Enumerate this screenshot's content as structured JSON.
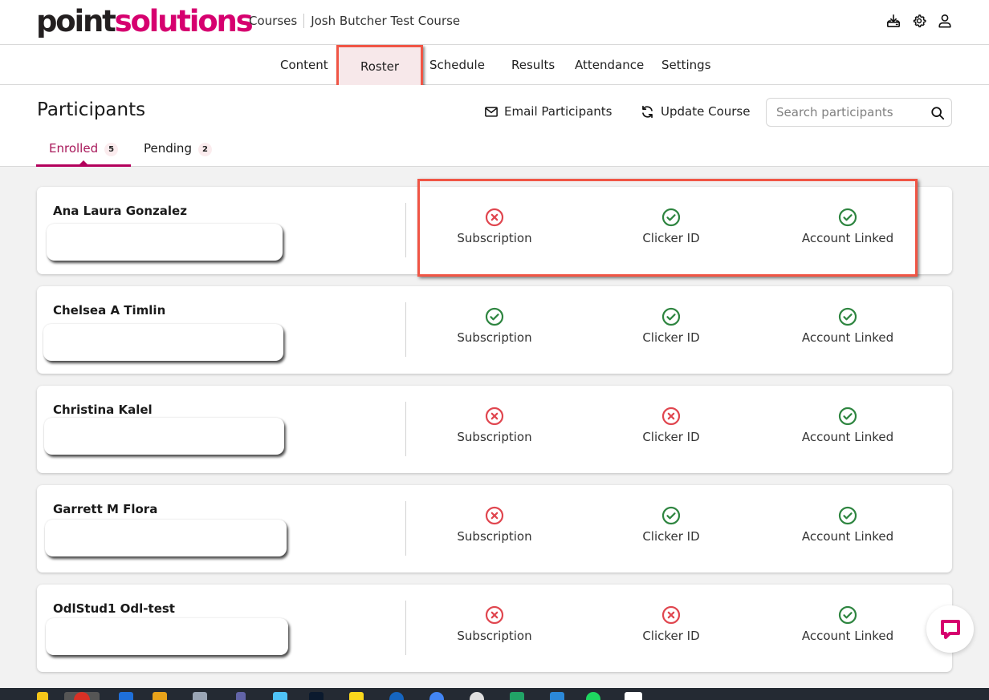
{
  "header": {
    "logo_dark": "point",
    "logo_pink": "solutions",
    "breadcrumb": [
      "Courses",
      "Josh Butcher Test Course"
    ],
    "icons": [
      "download-icon",
      "gear-icon",
      "user-icon"
    ]
  },
  "nav": {
    "items": [
      {
        "label": "Content"
      },
      {
        "label": "Roster",
        "active": true
      },
      {
        "label": "Schedule"
      },
      {
        "label": "Results"
      },
      {
        "label": "Attendance"
      },
      {
        "label": "Settings"
      }
    ]
  },
  "participants": {
    "title": "Participants",
    "email_label": "Email Participants",
    "update_label": "Update Course",
    "search_placeholder": "Search participants",
    "tabs": [
      {
        "label": "Enrolled",
        "count": "5",
        "active": true
      },
      {
        "label": "Pending",
        "count": "2"
      }
    ]
  },
  "status_labels": {
    "subscription": "Subscription",
    "clicker": "Clicker ID",
    "account": "Account Linked"
  },
  "rows": [
    {
      "name": "Ana Laura Gonzalez",
      "subscription": "missing",
      "clicker": "ok",
      "account": "ok"
    },
    {
      "name": "Chelsea A Timlin",
      "subscription": "ok",
      "clicker": "ok",
      "account": "ok"
    },
    {
      "name": "Christina Kalel",
      "subscription": "missing",
      "clicker": "missing",
      "account": "ok"
    },
    {
      "name": "Garrett M Flora",
      "subscription": "missing",
      "clicker": "ok",
      "account": "ok"
    },
    {
      "name": "OdlStud1 Odl-test",
      "subscription": "missing",
      "clicker": "missing",
      "account": "ok"
    }
  ],
  "colors": {
    "brand_pink": "#d6006f",
    "ok_green": "#2e8540",
    "missing_red": "#e0464f",
    "highlight_red": "#f05545"
  }
}
